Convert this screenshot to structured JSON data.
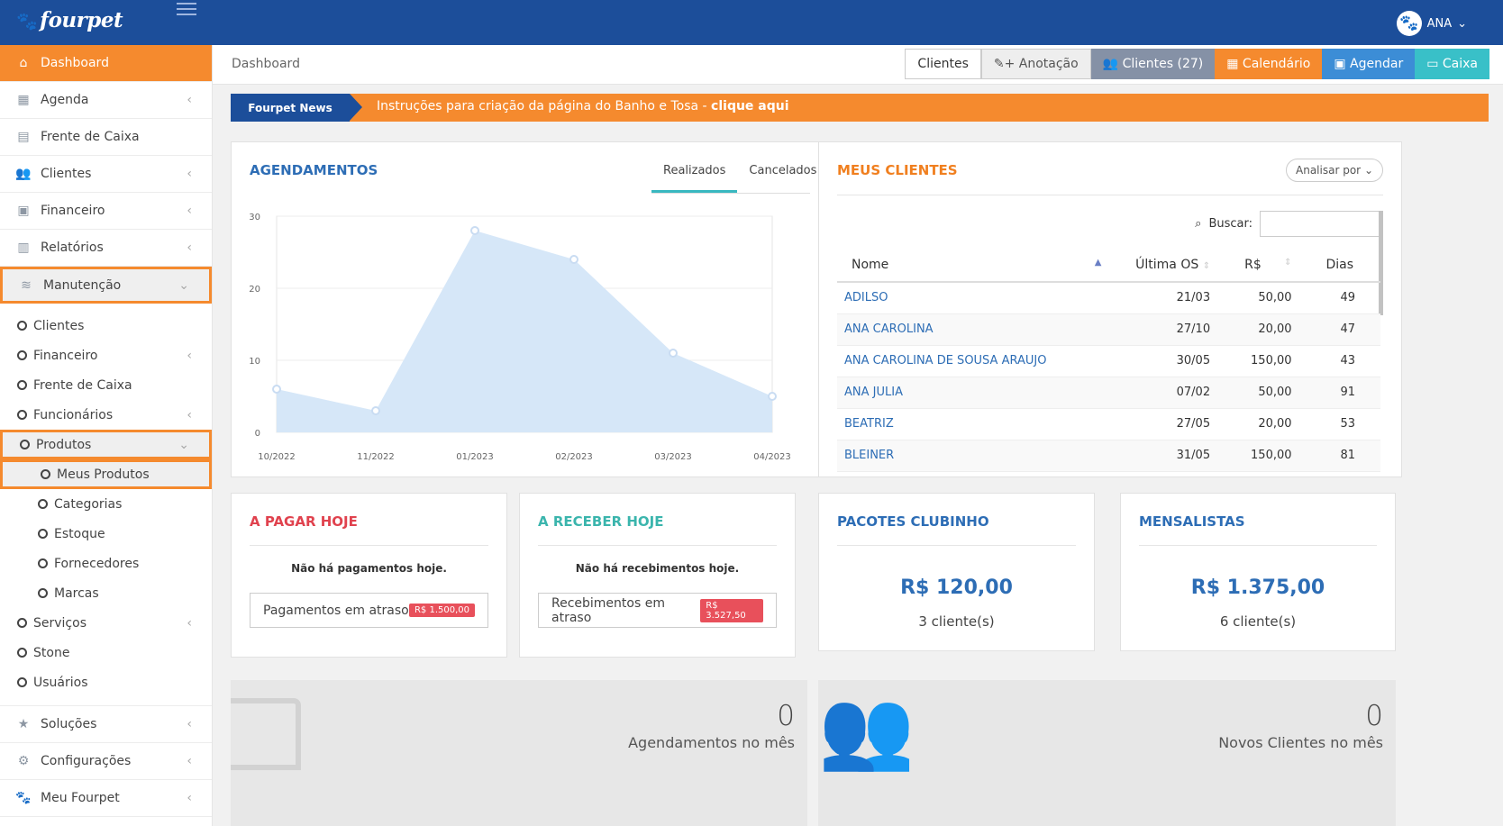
{
  "app": {
    "logo": "fourpet",
    "user": "ANA"
  },
  "sidebar": {
    "items": [
      {
        "label": "Dashboard"
      },
      {
        "label": "Agenda"
      },
      {
        "label": "Frente de Caixa"
      },
      {
        "label": "Clientes"
      },
      {
        "label": "Financeiro"
      },
      {
        "label": "Relatórios"
      },
      {
        "label": "Manutenção"
      }
    ],
    "sub": [
      {
        "label": "Clientes"
      },
      {
        "label": "Financeiro"
      },
      {
        "label": "Frente de Caixa"
      },
      {
        "label": "Funcionários"
      },
      {
        "label": "Produtos"
      },
      {
        "label": "Meus Produtos"
      },
      {
        "label": "Categorias"
      },
      {
        "label": "Estoque"
      },
      {
        "label": "Fornecedores"
      },
      {
        "label": "Marcas"
      },
      {
        "label": "Serviços"
      },
      {
        "label": "Stone"
      },
      {
        "label": "Usuários"
      }
    ],
    "bottom": [
      {
        "label": "Soluções"
      },
      {
        "label": "Configurações"
      },
      {
        "label": "Meu Fourpet"
      }
    ]
  },
  "breadcrumb": "Dashboard",
  "buttons": {
    "clientes": "Clientes",
    "anotacao": "+ Anotação",
    "clientes_count": "Clientes (27)",
    "calendario": "Calendário",
    "agendar": "Agendar",
    "caixa": "Caixa"
  },
  "news": {
    "tag": "Fourpet News",
    "text": "Instruções para criação da página do Banho e Tosa - ",
    "link": "clique aqui"
  },
  "agendamentos": {
    "title": "AGENDAMENTOS",
    "tab1": "Realizados",
    "tab2": "Cancelados"
  },
  "chart_data": {
    "type": "area",
    "title": "",
    "x": [
      "10/2022",
      "11/2022",
      "01/2023",
      "02/2023",
      "03/2023",
      "04/2023"
    ],
    "values": [
      6,
      3,
      28,
      24,
      11,
      5
    ],
    "ylim": [
      0,
      30
    ],
    "yticks": [
      "0",
      "10",
      "20",
      "30"
    ],
    "colors": {
      "fill": "#d6e7f8",
      "point": "#c9dcf2"
    }
  },
  "clientes": {
    "title": "MEUS CLIENTES",
    "analisar": "Analisar por",
    "buscar": "Buscar:",
    "headers": [
      "Nome",
      "Última OS",
      "R$",
      "Dias"
    ],
    "rows": [
      [
        "ADILSO",
        "21/03",
        "50,00",
        "49"
      ],
      [
        "ANA CAROLINA",
        "27/10",
        "20,00",
        "47"
      ],
      [
        "ANA CAROLINA DE SOUSA ARAUJO",
        "30/05",
        "150,00",
        "43"
      ],
      [
        "ANA JULIA",
        "07/02",
        "50,00",
        "91"
      ],
      [
        "BEATRIZ",
        "27/05",
        "20,00",
        "53"
      ],
      [
        "BLEINER",
        "31/05",
        "150,00",
        "81"
      ]
    ]
  },
  "pagar": {
    "title": "A PAGAR HOJE",
    "msg": "Não há pagamentos hoje.",
    "late": "Pagamentos em atraso",
    "badge": "R$ 1.500,00",
    "color": "#e0424e"
  },
  "receber": {
    "title": "A RECEBER HOJE",
    "msg": "Não há recebimentos hoje.",
    "late": "Recebimentos em atraso",
    "badge": "R$ 3.527,50",
    "color": "#3bb5ad"
  },
  "pacotes": {
    "title": "PACOTES CLUBINHO",
    "value": "R$ 120,00",
    "count": "3 cliente(s)"
  },
  "mensalistas": {
    "title": "MENSALISTAS",
    "value": "R$ 1.375,00",
    "count": "6 cliente(s)"
  },
  "stats": {
    "ag_num": "0",
    "ag_label": "Agendamentos no mês",
    "cl_num": "0",
    "cl_label": "Novos Clientes no mês"
  }
}
